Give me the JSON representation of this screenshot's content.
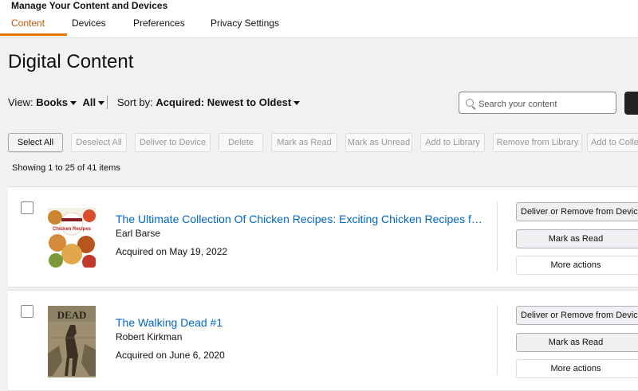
{
  "header": {
    "title": "Manage Your Content and Devices",
    "tabs": [
      {
        "label": "Content",
        "active": true
      },
      {
        "label": "Devices",
        "active": false
      },
      {
        "label": "Preferences",
        "active": false
      },
      {
        "label": "Privacy Settings",
        "active": false
      }
    ]
  },
  "page": {
    "title": "Digital Content"
  },
  "filters": {
    "view_label": "View:",
    "view_type": "Books",
    "view_scope": "All",
    "sort_label": "Sort by:",
    "sort_value": "Acquired: Newest to Oldest"
  },
  "search": {
    "placeholder": "Search your content"
  },
  "toolbar": {
    "select_all": "Select All",
    "deselect_all": "Deselect All",
    "deliver_to_device": "Deliver to Device",
    "delete": "Delete",
    "mark_as_read": "Mark as Read",
    "mark_as_unread": "Mark as Unread",
    "add_to_library": "Add to Library",
    "remove_from_library": "Remove from Library",
    "add_to_collection": "Add to Colle"
  },
  "showing": "Showing 1 to 25 of 41 items",
  "items": [
    {
      "title": "The Ultimate Collection Of Chicken Recipes: Exciting Chicken Recipes f…",
      "author": "Earl Barse",
      "acquired": "Acquired on May 19, 2022",
      "cover_text": "Chicken Recipes",
      "actions": {
        "deliver": "Deliver or Remove from Devic",
        "mark": "Mark as Read",
        "more": "More actions"
      }
    },
    {
      "title": "The Walking Dead #1",
      "author": "Robert Kirkman",
      "acquired": "Acquired on June 6, 2020",
      "cover_text": "DEAD",
      "actions": {
        "deliver": "Deliver or Remove from Devic",
        "mark": "Mark as Read",
        "more": "More actions"
      }
    }
  ],
  "colors": {
    "link": "#0066c0",
    "tab_active": "#c45500",
    "underline": "#e77600",
    "background": "#f0f2f2"
  }
}
